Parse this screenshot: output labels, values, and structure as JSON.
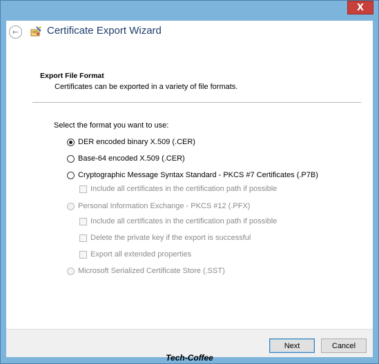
{
  "window": {
    "close_symbol": "X"
  },
  "header": {
    "title": "Certificate Export Wizard",
    "back_icon": "back-arrow-icon",
    "wizard_icon": "certificate-wizard-icon"
  },
  "section": {
    "title": "Export File Format",
    "description": "Certificates can be exported in a variety of file formats."
  },
  "prompt": "Select the format you want to use:",
  "options": {
    "der": {
      "label": "DER encoded binary X.509 (.CER)",
      "selected": true,
      "enabled": true
    },
    "base64": {
      "label": "Base-64 encoded X.509 (.CER)",
      "selected": false,
      "enabled": true
    },
    "pkcs7": {
      "label": "Cryptographic Message Syntax Standard - PKCS #7 Certificates (.P7B)",
      "selected": false,
      "enabled": true
    },
    "pkcs7_include": {
      "label": "Include all certificates in the certification path if possible",
      "checked": false,
      "enabled": false
    },
    "pfx": {
      "label": "Personal Information Exchange - PKCS #12 (.PFX)",
      "selected": false,
      "enabled": false
    },
    "pfx_include": {
      "label": "Include all certificates in the certification path if possible",
      "checked": false,
      "enabled": false
    },
    "pfx_delete_key": {
      "label": "Delete the private key if the export is successful",
      "checked": false,
      "enabled": false
    },
    "pfx_export_ext": {
      "label": "Export all extended properties",
      "checked": false,
      "enabled": false
    },
    "sst": {
      "label": "Microsoft Serialized Certificate Store (.SST)",
      "selected": false,
      "enabled": false
    }
  },
  "buttons": {
    "next": "Next",
    "cancel": "Cancel"
  },
  "watermark": "Tech-Coffee",
  "colors": {
    "title_text": "#1e3d6b",
    "window_frame": "#7db4dc",
    "close_button": "#c7403a"
  }
}
